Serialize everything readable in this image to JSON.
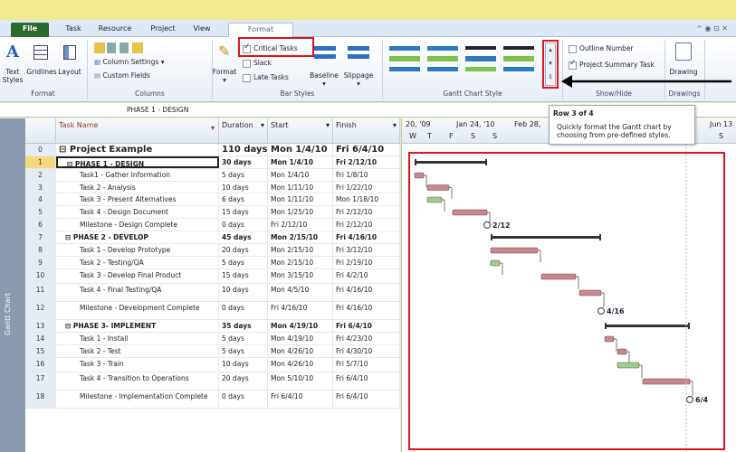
{
  "tabs": [
    "File",
    "Task",
    "Resource",
    "Project",
    "View",
    "Format"
  ],
  "ribbon": {
    "format_group": {
      "label": "Format",
      "text_styles": "Text Styles",
      "gridlines": "Gridlines",
      "layout": "Layout"
    },
    "columns_group": {
      "label": "Columns",
      "format": "Format",
      "column_settings": "Column Settings",
      "custom_fields": "Custom Fields"
    },
    "bar_styles_group": {
      "label": "Bar Styles",
      "critical_tasks": "Critical Tasks",
      "slack": "Slack",
      "late_tasks": "Late Tasks",
      "baseline": "Baseline",
      "slippage": "Slippage"
    },
    "gantt_style_group": {
      "label": "Gantt Chart Style"
    },
    "show_hide_group": {
      "label": "Show/Hide",
      "outline_number": "Outline Number",
      "project_summary_task": "Project Summary Task"
    },
    "drawings_group": {
      "label": "Drawings",
      "drawing": "Drawing"
    }
  },
  "formula_bar": {
    "value": "PHASE 1 - DESIGN"
  },
  "tooltip": {
    "title": "Row 3 of 4",
    "body": "Quickly format the Gantt chart by choosing from pre-defined styles."
  },
  "side_label": "Gantt Chart",
  "columns": {
    "name": "Task Name",
    "duration": "Duration",
    "start": "Start",
    "finish": "Finish"
  },
  "timescale": {
    "top": [
      "20, '09",
      "Jan 24, '10",
      "Feb 28,",
      "Jun 13"
    ],
    "bottom": [
      "W",
      "T",
      "F",
      "S",
      "S",
      "S"
    ]
  },
  "rows": [
    {
      "id": "0",
      "name": "Project Example",
      "duration": "110 days",
      "start": "Mon 1/4/10",
      "finish": "Fri 6/4/10",
      "type": "project"
    },
    {
      "id": "1",
      "name": "PHASE 1 - DESIGN",
      "duration": "30 days",
      "start": "Mon 1/4/10",
      "finish": "Fri 2/12/10",
      "type": "summary"
    },
    {
      "id": "2",
      "name": "Task1 - Gather Information",
      "duration": "5 days",
      "start": "Mon 1/4/10",
      "finish": "Fri 1/8/10",
      "type": "task"
    },
    {
      "id": "3",
      "name": "Task 2 - Analysis",
      "duration": "10 days",
      "start": "Mon 1/11/10",
      "finish": "Fri 1/22/10",
      "type": "task"
    },
    {
      "id": "4",
      "name": "Task 3 - Present Alternatives",
      "duration": "6 days",
      "start": "Mon 1/11/10",
      "finish": "Mon 1/18/10",
      "type": "task"
    },
    {
      "id": "5",
      "name": "Task 4 - Design Document",
      "duration": "15 days",
      "start": "Mon 1/25/10",
      "finish": "Fri 2/12/10",
      "type": "task"
    },
    {
      "id": "6",
      "name": "Milestone - Design Complete",
      "duration": "0 days",
      "start": "Fri 2/12/10",
      "finish": "Fri 2/12/10",
      "type": "milestone"
    },
    {
      "id": "7",
      "name": "PHASE 2 - DEVELOP",
      "duration": "45 days",
      "start": "Mon 2/15/10",
      "finish": "Fri 4/16/10",
      "type": "summary"
    },
    {
      "id": "8",
      "name": "Task 1 - Develop Prototype",
      "duration": "20 days",
      "start": "Mon 2/15/10",
      "finish": "Fri 3/12/10",
      "type": "task"
    },
    {
      "id": "9",
      "name": "Task 2 - Testing/QA",
      "duration": "5 days",
      "start": "Mon 2/15/10",
      "finish": "Fri 2/19/10",
      "type": "task"
    },
    {
      "id": "10",
      "name": "Task 3 - Develop Final Product",
      "duration": "15 days",
      "start": "Mon 3/15/10",
      "finish": "Fri 4/2/10",
      "type": "task"
    },
    {
      "id": "11",
      "name": "Task 4 - Final Testing/QA",
      "duration": "10 days",
      "start": "Mon 4/5/10",
      "finish": "Fri 4/16/10",
      "type": "task"
    },
    {
      "id": "12",
      "name": "Milestone - Development Complete",
      "duration": "0 days",
      "start": "Fri 4/16/10",
      "finish": "Fri 4/16/10",
      "type": "milestone"
    },
    {
      "id": "13",
      "name": "PHASE 3- IMPLEMENT",
      "duration": "35 days",
      "start": "Mon 4/19/10",
      "finish": "Fri 6/4/10",
      "type": "summary"
    },
    {
      "id": "14",
      "name": "Task 1 - Install",
      "duration": "5 days",
      "start": "Mon 4/19/10",
      "finish": "Fri 4/23/10",
      "type": "task"
    },
    {
      "id": "15",
      "name": "Task 2 - Test",
      "duration": "5 days",
      "start": "Mon 4/26/10",
      "finish": "Fri 4/30/10",
      "type": "task"
    },
    {
      "id": "16",
      "name": "Task 3 - Train",
      "duration": "10 days",
      "start": "Mon 4/26/10",
      "finish": "Fri 5/7/10",
      "type": "task"
    },
    {
      "id": "17",
      "name": "Task 4 - Transition to Operations",
      "duration": "20 days",
      "start": "Mon 5/10/10",
      "finish": "Fri 6/4/10",
      "type": "task"
    },
    {
      "id": "18",
      "name": "Milestone - Implementation Complete",
      "duration": "0 days",
      "start": "Fri 6/4/10",
      "finish": "Fri 6/4/10",
      "type": "milestone"
    }
  ],
  "milestone_labels": [
    "2/12",
    "4/16",
    "6/4"
  ],
  "colors": {
    "critical_bar": "#c9868e",
    "normal_bar": "#9ccf8c",
    "summary_bar": "#333333",
    "highlight": "#e0141e",
    "selected_row": "#f5d77c"
  }
}
